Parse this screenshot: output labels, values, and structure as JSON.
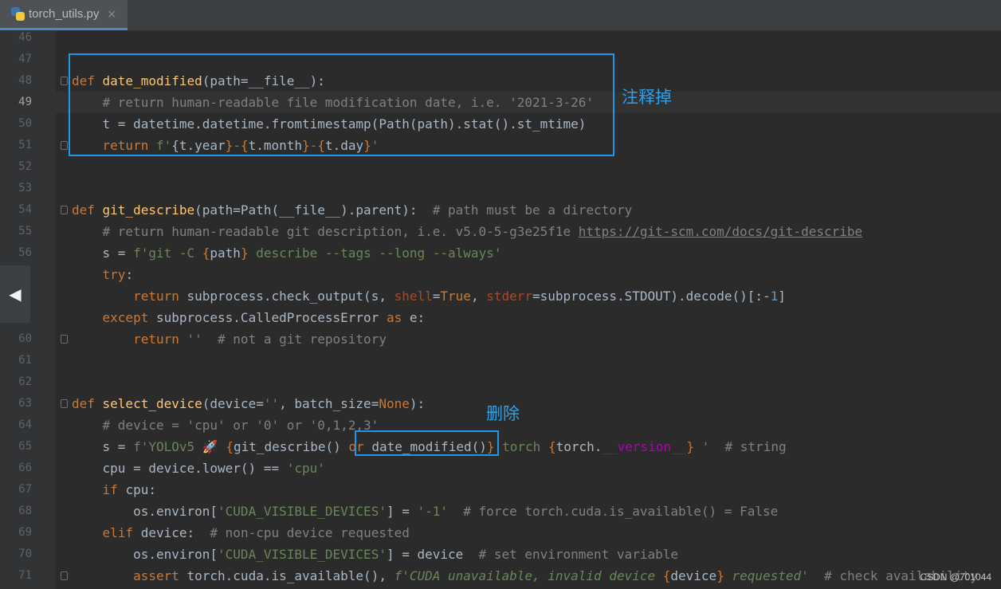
{
  "tab": {
    "filename": "torch_utils.py",
    "close": "×",
    "icon": "python-file-icon"
  },
  "annotations": {
    "comment_out": "注释掉",
    "delete": "删除"
  },
  "watermark": "CSDN @701044",
  "nav": {
    "arrow": "◀"
  },
  "lines": [
    {
      "n": "46",
      "tokens": []
    },
    {
      "n": "47",
      "tokens": []
    },
    {
      "n": "48",
      "fold": true,
      "tokens": [
        [
          "def ",
          "kw"
        ],
        [
          "date_modified",
          "fn"
        ],
        [
          "(path=__file__):",
          ""
        ]
      ]
    },
    {
      "n": "49",
      "current": true,
      "tokens": [
        [
          "    # return human-readable file modification date, i.e. '2021-3-26'",
          "cm"
        ]
      ]
    },
    {
      "n": "50",
      "tokens": [
        [
          "    t = datetime.datetime.fromtimestamp(Path(path).stat().st_mtime)",
          ""
        ]
      ]
    },
    {
      "n": "51",
      "fold": true,
      "tokens": [
        [
          "    return ",
          "kw"
        ],
        [
          "f'",
          "st"
        ],
        [
          "{",
          ""
        ],
        [
          "t.year",
          ""
        ],
        [
          "}",
          "kw"
        ],
        [
          "-",
          "st"
        ],
        [
          "{",
          "kw"
        ],
        [
          "t.month",
          ""
        ],
        [
          "}",
          "kw"
        ],
        [
          "-",
          "st"
        ],
        [
          "{",
          "kw"
        ],
        [
          "t.day",
          ""
        ],
        [
          "}",
          "kw"
        ],
        [
          "'",
          "st"
        ]
      ]
    },
    {
      "n": "52",
      "tokens": []
    },
    {
      "n": "53",
      "tokens": []
    },
    {
      "n": "54",
      "fold": true,
      "tokens": [
        [
          "def ",
          "kw"
        ],
        [
          "git_describe",
          "fn"
        ],
        [
          "(path=Path(__file__).parent):  ",
          ""
        ],
        [
          "# path must be a directory",
          "cm"
        ]
      ]
    },
    {
      "n": "55",
      "tokens": [
        [
          "    # return human-readable git description, i.e. v5.0-5-g3e25f1e ",
          "cm"
        ],
        [
          "https://git-scm.com/docs/git-describe",
          "ln-url"
        ]
      ]
    },
    {
      "n": "56",
      "tokens": [
        [
          "    s = ",
          ""
        ],
        [
          "f'git -C ",
          "st"
        ],
        [
          "{",
          "kw"
        ],
        [
          "path",
          ""
        ],
        [
          "}",
          "kw"
        ],
        [
          " describe --tags --long --always'",
          "st"
        ]
      ]
    },
    {
      "n": "",
      "tokens": [
        [
          "    try",
          "kw"
        ],
        [
          ":",
          ""
        ]
      ]
    },
    {
      "n": "",
      "tokens": [
        [
          "        return ",
          "kw"
        ],
        [
          "subprocess.check_output(s, ",
          ""
        ],
        [
          "shell",
          "pm"
        ],
        [
          "=",
          ""
        ],
        [
          "True",
          "kw"
        ],
        [
          ", ",
          ""
        ],
        [
          "stderr",
          "pm"
        ],
        [
          "=subprocess.STDOUT).decode()[:-",
          ""
        ],
        [
          "1",
          "nm"
        ],
        [
          "]",
          ""
        ]
      ]
    },
    {
      "n": "",
      "tokens": [
        [
          "    except ",
          "kw"
        ],
        [
          "subprocess.CalledProcessError ",
          ""
        ],
        [
          "as ",
          "kw"
        ],
        [
          "e:",
          ""
        ]
      ]
    },
    {
      "n": "60",
      "fold": true,
      "tokens": [
        [
          "        return ",
          "kw"
        ],
        [
          "''",
          "st"
        ],
        [
          "  ",
          ""
        ],
        [
          "# not a git repository",
          "cm"
        ]
      ]
    },
    {
      "n": "61",
      "tokens": []
    },
    {
      "n": "62",
      "tokens": []
    },
    {
      "n": "63",
      "fold": true,
      "tokens": [
        [
          "def ",
          "kw"
        ],
        [
          "select_device",
          "fn"
        ],
        [
          "(device=",
          ""
        ],
        [
          "''",
          "st"
        ],
        [
          ", batch_size=",
          ""
        ],
        [
          "None",
          "kw"
        ],
        [
          "):",
          ""
        ]
      ]
    },
    {
      "n": "64",
      "tokens": [
        [
          "    # device = 'cpu' or '0' or '0,1,2,3'",
          "cm"
        ]
      ]
    },
    {
      "n": "65",
      "tokens": [
        [
          "    s = ",
          ""
        ],
        [
          "f'YOLOv5 🚀 ",
          "st"
        ],
        [
          "{",
          "kw"
        ],
        [
          "git_describe() ",
          ""
        ],
        [
          "or ",
          "kw"
        ],
        [
          "date_modified()",
          ""
        ],
        [
          "}",
          "kw"
        ],
        [
          " torch ",
          "st"
        ],
        [
          "{",
          "kw"
        ],
        [
          "torch.",
          ""
        ],
        [
          "__version__",
          "dn"
        ],
        [
          "}",
          "kw"
        ],
        [
          " '",
          "st"
        ],
        [
          "  ",
          ""
        ],
        [
          "# string",
          "cm"
        ]
      ]
    },
    {
      "n": "66",
      "tokens": [
        [
          "    cpu = device.lower() == ",
          ""
        ],
        [
          "'cpu'",
          "st"
        ]
      ]
    },
    {
      "n": "67",
      "tokens": [
        [
          "    if ",
          "kw"
        ],
        [
          "cpu:",
          ""
        ]
      ]
    },
    {
      "n": "68",
      "tokens": [
        [
          "        os.environ[",
          ""
        ],
        [
          "'CUDA_VISIBLE_DEVICES'",
          "st"
        ],
        [
          "] = ",
          ""
        ],
        [
          "'-1'",
          "st"
        ],
        [
          "  ",
          ""
        ],
        [
          "# force torch.cuda.is_available() = False",
          "cm"
        ]
      ]
    },
    {
      "n": "69",
      "tokens": [
        [
          "    elif ",
          "kw"
        ],
        [
          "device:  ",
          ""
        ],
        [
          "# non-cpu device requested",
          "cm"
        ]
      ]
    },
    {
      "n": "70",
      "tokens": [
        [
          "        os.environ[",
          ""
        ],
        [
          "'CUDA_VISIBLE_DEVICES'",
          "st"
        ],
        [
          "] = device  ",
          ""
        ],
        [
          "# set environment variable",
          "cm"
        ]
      ]
    },
    {
      "n": "71",
      "fold": true,
      "tokens": [
        [
          "        assert ",
          "kw"
        ],
        [
          "torch.cuda.is_available(), ",
          ""
        ],
        [
          "f'CUDA unavailable, invalid device ",
          "fi"
        ],
        [
          "{",
          "kw"
        ],
        [
          "device",
          ""
        ],
        [
          "}",
          "kw"
        ],
        [
          " requested'",
          "fi"
        ],
        [
          "  ",
          ""
        ],
        [
          "# check availability",
          "cm"
        ]
      ]
    }
  ]
}
